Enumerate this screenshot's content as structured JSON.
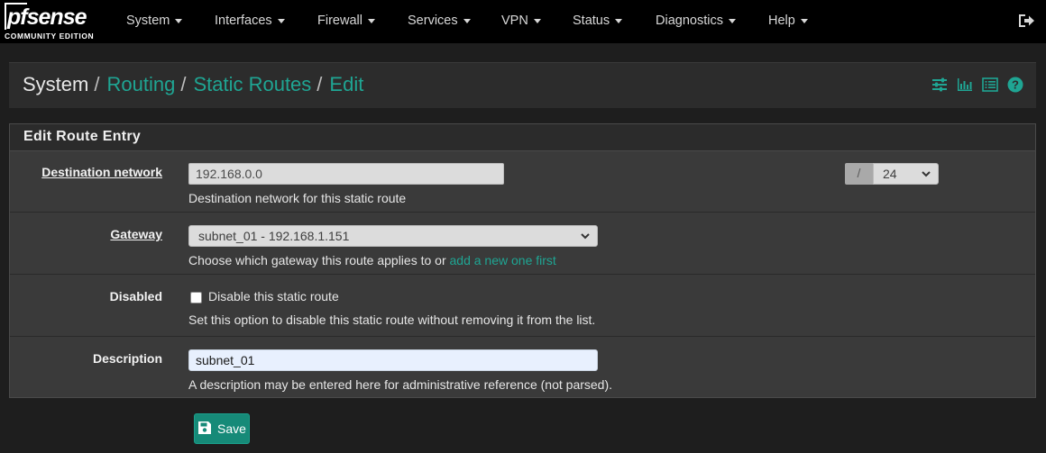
{
  "brand": {
    "name_pf": "pf",
    "name_sense": "sense",
    "edition": "COMMUNITY EDITION"
  },
  "nav": {
    "items": [
      {
        "label": "System"
      },
      {
        "label": "Interfaces"
      },
      {
        "label": "Firewall"
      },
      {
        "label": "Services"
      },
      {
        "label": "VPN"
      },
      {
        "label": "Status"
      },
      {
        "label": "Diagnostics"
      },
      {
        "label": "Help"
      }
    ],
    "logout_icon": "sign-out-icon"
  },
  "breadcrumb": {
    "items": [
      {
        "label": "System"
      },
      {
        "label": "Routing"
      },
      {
        "label": "Static Routes"
      },
      {
        "label": "Edit"
      }
    ],
    "separator": "/",
    "icons": [
      "sliders-icon",
      "bar-chart-icon",
      "list-icon",
      "question-circle-icon"
    ]
  },
  "panel": {
    "title": "Edit Route Entry",
    "rows": {
      "destination": {
        "label": "Destination network",
        "value": "192.168.0.0",
        "cidr_prefix": "/",
        "cidr_value": "24",
        "help": "Destination network for this static route"
      },
      "gateway": {
        "label": "Gateway",
        "value": "subnet_01 - 192.168.1.151",
        "help": "Choose which gateway this route applies to or ",
        "help_link": "add a new one first"
      },
      "disabled": {
        "label": "Disabled",
        "checkbox_label": "Disable this static route",
        "checked": false,
        "help": "Set this option to disable this static route without removing it from the list."
      },
      "description": {
        "label": "Description",
        "value": "subnet_01",
        "help": "A description may be entered here for administrative reference (not parsed)."
      }
    }
  },
  "actions": {
    "save_label": "Save",
    "save_icon": "floppy-disk-icon"
  },
  "colors": {
    "accent": "#1fa593",
    "save": "#168a78",
    "navbar": "#000000",
    "panel": "#3a3a3a"
  }
}
